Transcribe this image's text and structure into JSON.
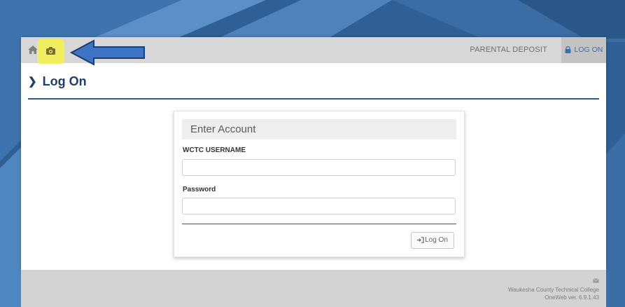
{
  "topbar": {
    "nav_items": [
      {
        "label": "PARENTAL DEPOSIT"
      },
      {
        "label": "LOG ON",
        "active": true
      }
    ]
  },
  "page": {
    "title": "Log On"
  },
  "login_form": {
    "header": "Enter Account",
    "username_label": "WCTC USERNAME",
    "username_value": "",
    "password_label": "Password",
    "password_value": "",
    "submit_label": "Log On"
  },
  "footer": {
    "institution": "Waukesha County Technical College",
    "version": "OneWeb ver. 6.9.1.43"
  },
  "colors": {
    "accent": "#2d5b8c",
    "title": "#1f3f68",
    "highlight": "#f2f05a",
    "topbar": "#d7d7d7"
  },
  "icons": {
    "home": "home-icon",
    "camera": "camera-icon",
    "lock": "lock-icon",
    "sign_in": "sign-in-icon",
    "mail": "mail-icon",
    "annotation_arrow": "arrow-left-icon"
  }
}
